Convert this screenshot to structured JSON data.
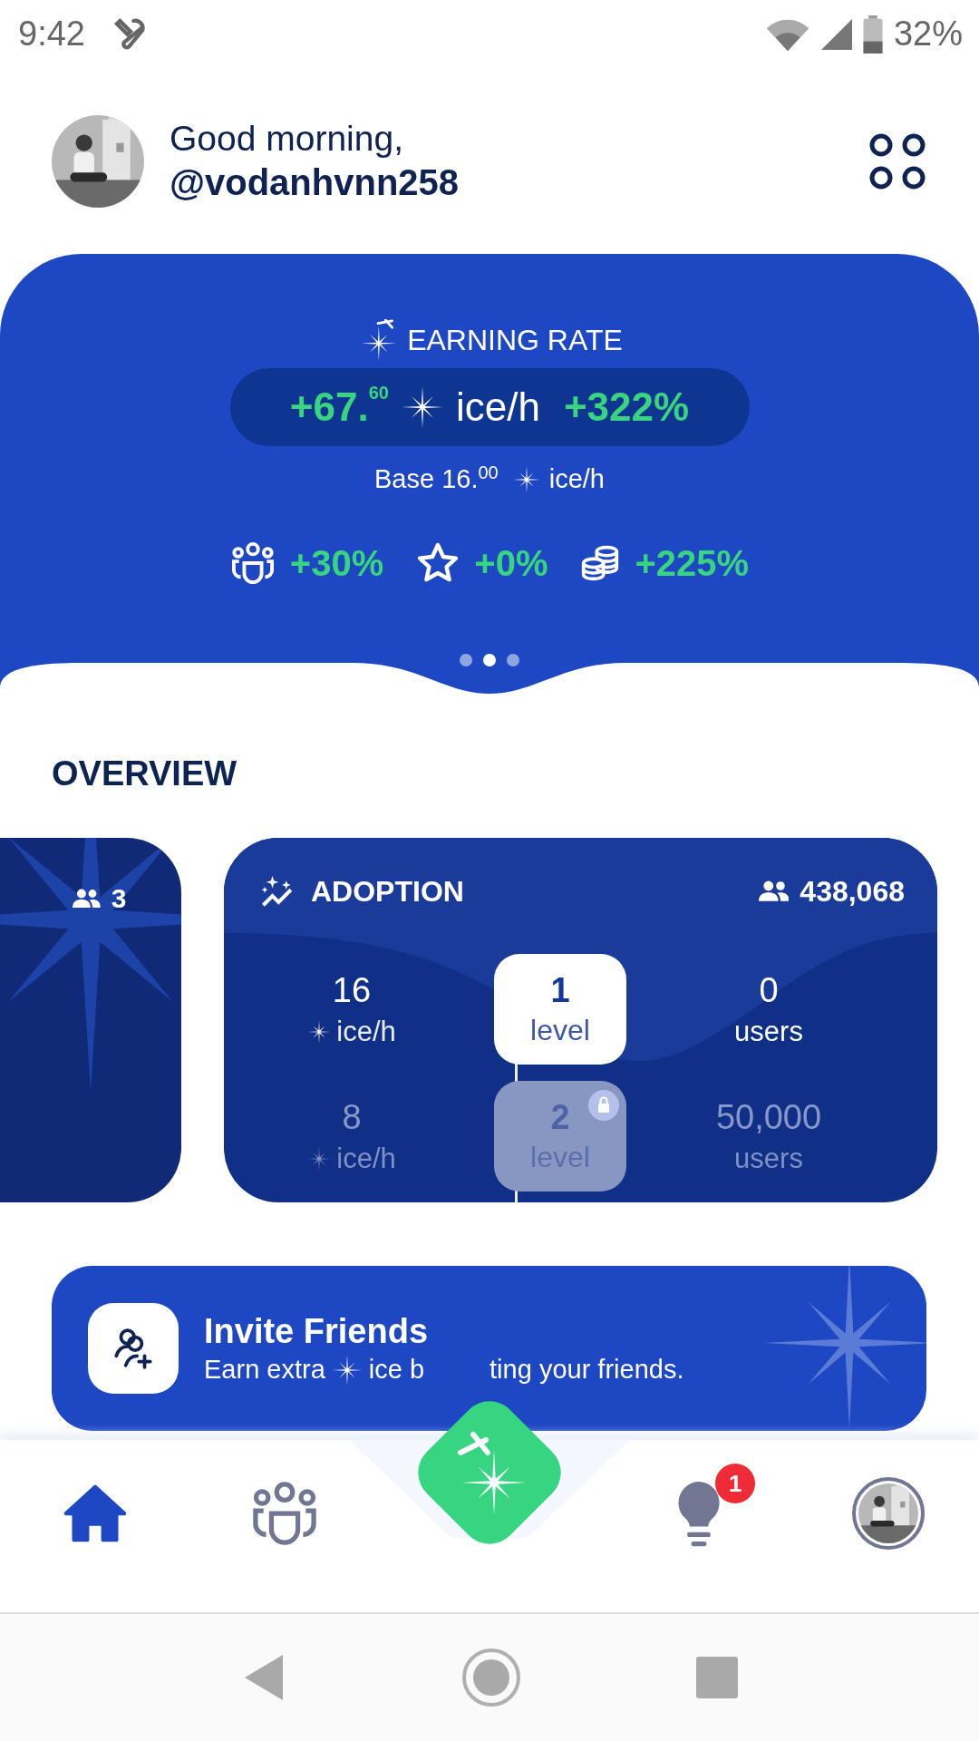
{
  "status_bar": {
    "time": "9:42",
    "battery": "32%"
  },
  "header": {
    "greeting": "Good morning,",
    "username": "@vodanhvnn258"
  },
  "earning_rate": {
    "title": "EARNING RATE",
    "rate": "+67.$^{60}$",
    "unit": "ice/h",
    "boost": "+322%",
    "base": "Base 16.$^{00}$",
    "base_unit": "ice/h",
    "bonuses": [
      {
        "kind": "team",
        "value": "+30%"
      },
      {
        "kind": "star",
        "value": "+0%"
      },
      {
        "kind": "coins",
        "value": "+225%"
      }
    ],
    "pages": [
      {
        "selected": false
      },
      {
        "selected": true
      },
      {
        "selected": false
      }
    ]
  },
  "overview": {
    "title": "OVERVIEW",
    "side_card": {
      "count": "3"
    },
    "adoption": {
      "title": "ADOPTION",
      "total_users": "438,068",
      "levels": [
        {
          "rate": "16",
          "unit": "ice/h",
          "level": "1",
          "level_label": "level",
          "users": "0",
          "users_label": "users",
          "locked": false
        },
        {
          "rate": "8",
          "unit": "ice/h",
          "level": "2",
          "level_label": "level",
          "users": "50,000",
          "users_label": "users",
          "locked": true
        }
      ]
    }
  },
  "invite": {
    "title": "Invite Friends",
    "subtitle_start": "Earn extra",
    "subtitle_mid": "ice b",
    "subtitle_end": "ting your friends."
  },
  "nav": [
    {
      "kind": "home",
      "selected": true
    },
    {
      "kind": "team",
      "selected": false
    },
    {
      "kind": "tips",
      "selected": false,
      "badge": "1"
    },
    {
      "kind": "profile",
      "selected": false
    }
  ]
}
